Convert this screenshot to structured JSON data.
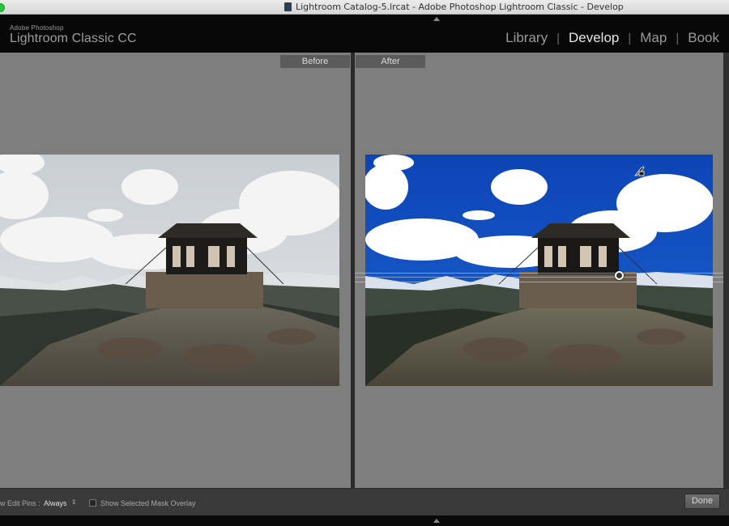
{
  "window": {
    "title": "Lightroom Catalog-5.lrcat - Adobe Photoshop Lightroom Classic - Develop"
  },
  "brand": {
    "company": "Adobe Photoshop",
    "product": "Lightroom Classic CC"
  },
  "modules": {
    "items": [
      "Library",
      "Develop",
      "Map",
      "Book"
    ],
    "active": "Develop"
  },
  "views": {
    "before_label": "Before",
    "after_label": "After"
  },
  "toolbar": {
    "edit_pins_label": "w Edit Pins :",
    "edit_pins_value": "Always",
    "mask_overlay_label": "Show Selected Mask Overlay",
    "mask_overlay_checked": false,
    "done_label": "Done"
  },
  "icons": {
    "brush_cursor": "brush-cursor-icon",
    "pin": "adjustment-pin-icon"
  },
  "colors": {
    "workspace": "#7e7e7e",
    "header": "#080808",
    "toolbar": "#3a3a3a",
    "active_module": "#e6e6e6",
    "sky_after": "#0f4fbf"
  }
}
